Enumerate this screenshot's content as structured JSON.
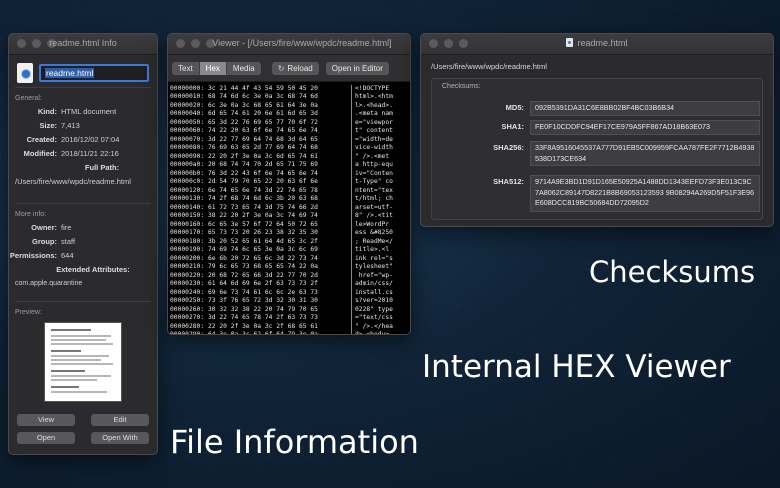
{
  "captions": {
    "checksums": "Checksums",
    "hex": "Internal HEX Viewer",
    "file_info": "File Information"
  },
  "info_window": {
    "title": "readme.html Info",
    "file_name": "readme.html",
    "general_label": "General:",
    "general": [
      {
        "key": "Kind:",
        "value": "HTML document"
      },
      {
        "key": "Size:",
        "value": "7,413"
      },
      {
        "key": "Created:",
        "value": "2016/12/02 07:04"
      },
      {
        "key": "Modified:",
        "value": "2018/11/21 22:16"
      }
    ],
    "full_path_label": "Full Path:",
    "full_path": "/Users/fire/www/wpdc/readme.html",
    "more_info_label": "More info:",
    "more": [
      {
        "key": "Owner:",
        "value": "fire"
      },
      {
        "key": "Group:",
        "value": "staff"
      },
      {
        "key": "Permissions:",
        "value": "644"
      }
    ],
    "ext_attr_label": "Extended Attributes:",
    "ext_attr_value": "com.apple.quarantine",
    "preview_label": "Preview:",
    "buttons": {
      "view": "View",
      "edit": "Edit",
      "open": "Open",
      "open_with": "Open With"
    }
  },
  "hex_window": {
    "title": "Viewer - [/Users/fire/www/wpdc/readme.html]",
    "tabs": [
      "Text",
      "Hex",
      "Media"
    ],
    "active_tab": "Hex",
    "reload": "Reload",
    "open_in_editor": "Open in Editor",
    "rows": [
      {
        "off": "00000000:",
        "hex": "3c 21 44 4f 43 54 59 50 45 20",
        "asc": "<!DOCTYPE"
      },
      {
        "off": "00000010:",
        "hex": "68 74 6d 6c 3e 0a 3c 68 74 6d",
        "asc": "html>.<htm"
      },
      {
        "off": "00000020:",
        "hex": "6c 3e 0a 3c 68 65 61 64 3e 0a",
        "asc": "l>.<head>."
      },
      {
        "off": "00000040:",
        "hex": "6d 65 74 61 20 6e 61 6d 65 3d",
        "asc": ".<meta nam"
      },
      {
        "off": "00000050:",
        "hex": "65 3d 22 76 69 65 77 70 6f 72",
        "asc": "e=\"viewpor"
      },
      {
        "off": "00000060:",
        "hex": "74 22 20 63 6f 6e 74 65 6e 74",
        "asc": "t\" content"
      },
      {
        "off": "00000070:",
        "hex": "3d 22 77 69 64 74 68 3d 64 65",
        "asc": "=\"width=de"
      },
      {
        "off": "00000080:",
        "hex": "76 69 63 65 2d 77 69 64 74 68",
        "asc": "vice-width"
      },
      {
        "off": "00000090:",
        "hex": "22 20 2f 3e 0a 3c 6d 65 74 61",
        "asc": "\" />.<met"
      },
      {
        "off": "000000a0:",
        "hex": "20 68 74 74 70 2d 65 71 75 69",
        "asc": "a http-equ"
      },
      {
        "off": "000000b0:",
        "hex": "76 3d 22 43 6f 6e 74 65 6e 74",
        "asc": "iv=\"Conten"
      },
      {
        "off": "000000c0:",
        "hex": "2d 54 79 70 65 22 20 63 6f 6e",
        "asc": "t-Type\" co"
      },
      {
        "off": "00000120:",
        "hex": "6e 74 65 6e 74 3d 22 74 65 78",
        "asc": "ntent=\"tex"
      },
      {
        "off": "00000130:",
        "hex": "74 2f 68 74 6d 6c 3b 20 63 68",
        "asc": "t/html; ch"
      },
      {
        "off": "00000140:",
        "hex": "61 72 73 65 74 3d 75 74 66 2d",
        "asc": "arset=utf-"
      },
      {
        "off": "00000150:",
        "hex": "38 22 20 2f 3e 0a 3c 74 69 74",
        "asc": "8\" />.<tit"
      },
      {
        "off": "00000160:",
        "hex": "6c 65 3e 57 6f 72 64 50 72 65",
        "asc": "le>WordPr"
      },
      {
        "off": "00000170:",
        "hex": "65 73 73 20 26 23 38 32 35 30",
        "asc": "ess &#8250"
      },
      {
        "off": "00000180:",
        "hex": "3b 20 52 65 61 64 4d 65 3c 2f",
        "asc": "; ReadMe</"
      },
      {
        "off": "00000190:",
        "hex": "74 69 74 6c 65 3e 0a 3c 6c 69",
        "asc": "title>.<l"
      },
      {
        "off": "00000200:",
        "hex": "6e 6b 20 72 65 6c 3d 22 73 74",
        "asc": "ink rel=\"s"
      },
      {
        "off": "00000210:",
        "hex": "79 6c 65 73 68 65 65 74 22 0a",
        "asc": "tylesheet\""
      },
      {
        "off": "00000220:",
        "hex": "20 68 72 65 66 3d 22 77 70 2d",
        "asc": " href=\"wp-"
      },
      {
        "off": "00000230:",
        "hex": "61 64 6d 69 6e 2f 63 73 73 2f",
        "asc": "admin/css/"
      },
      {
        "off": "00000240:",
        "hex": "69 6e 73 74 61 6c 6c 2e 63 73",
        "asc": "install.cs"
      },
      {
        "off": "00000250:",
        "hex": "73 3f 76 65 72 3d 32 30 31 30",
        "asc": "s?ver=2010"
      },
      {
        "off": "00000260:",
        "hex": "30 32 32 38 22 20 74 79 70 65",
        "asc": "0228\" type"
      },
      {
        "off": "00000270:",
        "hex": "3d 22 74 65 78 74 2f 63 73 73",
        "asc": "=\"text/css"
      },
      {
        "off": "00000280:",
        "hex": "22 20 2f 3e 0a 3c 2f 68 65 61",
        "asc": "\" />.</hea"
      },
      {
        "off": "00000290:",
        "hex": "64 3e 0a 3c 62 6f 64 79 3e 0a",
        "asc": "d>.<body>."
      },
      {
        "off": "00000300:",
        "hex": "3c 68 31 20 69 64 3d 22 6c 6f",
        "asc": "<h1 id=\"lo"
      }
    ]
  },
  "checksums_window": {
    "title": "readme.html",
    "path": "/Users/fire/www/wpdc/readme.html",
    "box_label": "Checksums:",
    "items": [
      {
        "label": "MD5:",
        "value": "092B5391DA31C6E8BB02BF4BC03B6B34"
      },
      {
        "label": "SHA1:",
        "value": "FE0F10CDDFC94EF17CE979A5FF867AD18B63E073"
      },
      {
        "label": "SHA256:",
        "value": "33F8A9516045537A777D91EB5C009959FCAA787FE2F7712B4938538D173CE634"
      },
      {
        "label": "SHA512:",
        "value": "9714A9E3BD1D91D165E50925A1488DD1343EEFD73F3E013C9C7A8062C89147D8221B8B69053123593 9B08294A269D5F51F3E96E608DCC819BC50684DD72095D2"
      }
    ]
  }
}
